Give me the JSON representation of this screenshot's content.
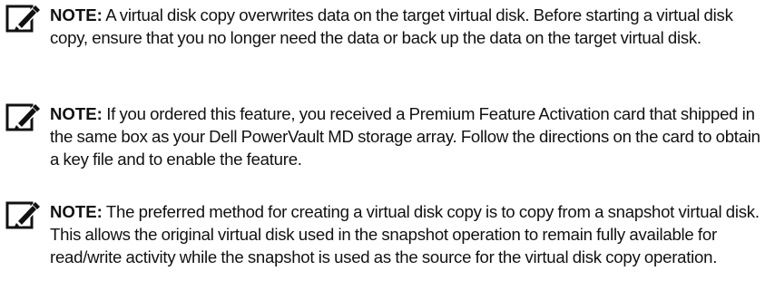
{
  "notes": [
    {
      "icon": "pencil-note-icon",
      "label": "NOTE:",
      "text": " A virtual disk copy overwrites data on the target virtual disk. Before starting a virtual disk copy, ensure that you no longer need the data or back up the data on the target virtual disk."
    },
    {
      "icon": "pencil-note-icon",
      "label": "NOTE:",
      "text": " If you ordered this feature, you received a Premium Feature Activation card that shipped in the same box as your Dell PowerVault MD storage array. Follow the directions on the card to obtain a key file and to enable the feature."
    },
    {
      "icon": "pencil-note-icon",
      "label": "NOTE:",
      "text": " The preferred method for creating a virtual disk copy is to copy from a snapshot virtual disk. This allows the original virtual disk used in the snapshot operation to remain fully available for read/write activity while the snapshot is used as the source for the virtual disk copy operation."
    }
  ]
}
